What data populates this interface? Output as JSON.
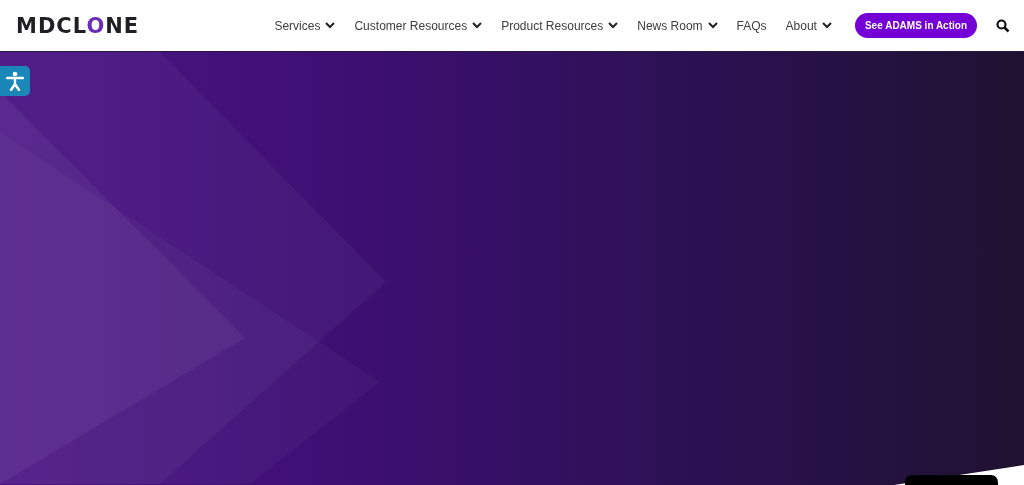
{
  "logo": {
    "before": "MDCL",
    "accent": "O",
    "after": "NE"
  },
  "nav": [
    {
      "label": "Services",
      "has_dropdown": true
    },
    {
      "label": "Customer Resources",
      "has_dropdown": true
    },
    {
      "label": "Product Resources",
      "has_dropdown": true
    },
    {
      "label": "News Room",
      "has_dropdown": true
    },
    {
      "label": "FAQs",
      "has_dropdown": false
    },
    {
      "label": "About",
      "has_dropdown": true
    }
  ],
  "cta": {
    "label": "See ADAMS in Action"
  }
}
